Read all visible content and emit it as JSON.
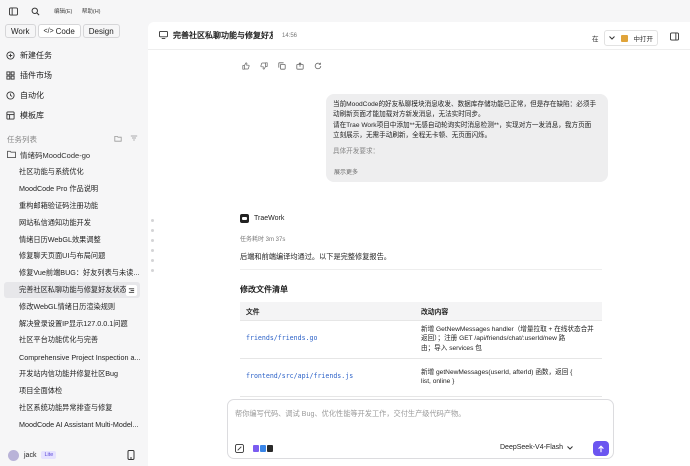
{
  "topbar": {
    "menu": [
      "编辑(E)",
      "帮助(H)"
    ]
  },
  "modes": [
    "Work",
    "Code",
    "Design"
  ],
  "nav": [
    "新建任务",
    "插件市场",
    "自动化",
    "模板库"
  ],
  "tasks_section": {
    "title": "任务列表"
  },
  "folder": {
    "name": "情绪码MoodCode-go"
  },
  "tasks": [
    "社区功能与系统优化",
    "MoodCode Pro 作品说明",
    "重构邮箱验证码注册功能",
    "网站私信通知功能开发",
    "情绪日历WebGL效果调整",
    "修复聊天页面UI与布局问题",
    "修复Vue前端BUG：好友列表与未读...",
    "完善社区私聊功能与修复好友状态",
    "修改WebGL情绪日历渲染规则",
    "解决登录设置IP显示127.0.0.1问题",
    "社区平台功能优化与完善",
    "Comprehensive Project Inspection a...",
    "开发站内信功能并修复社区Bug",
    "项目全面体检",
    "社区系统功能异常排查与修复",
    "MoodCode AI Assistant Multi-Model..."
  ],
  "active_task_index": 7,
  "user": {
    "name": "jack",
    "plan": "Lite"
  },
  "header": {
    "title": "完善社区私聊功能与修复好友...",
    "time": "14:56",
    "open_in_prefix": "在",
    "open_in_label": "中打开"
  },
  "bubble": {
    "lines": [
      "当前MoodCode的好友私聊模块消息收发、数据库存储功能已正常，但是存在缺陷：必须手",
      "动刷新页面才能加载对方新发消息，无法实时同步。",
      "请在Trae Work项目中添加**无感自动轮询实时消息检测**，实现对方一发消息，我方页面",
      "立刻展示，无需手动刷新，全程无卡顿、无页面闪烁。"
    ],
    "fade_line": "具体开发要求：",
    "expand": "展示更多"
  },
  "agent": {
    "name": "TraeWork",
    "elapsed": "任务耗时 3m 37s",
    "summary": "后端和前端编译均通过。以下是完整修复报告。",
    "section_title": "修改文件清单",
    "table_headers": [
      "文件",
      "改动内容"
    ],
    "rows": [
      {
        "file": "friends/friends.go",
        "desc_a": "新增 GetNewMessages handler（增量拉取 + 在线状态合并",
        "desc_b": "返回）；注册 GET /api/friends/chat/:userId/new 路",
        "desc_c": "由；导入 services 包"
      },
      {
        "file": "frontend/src/api/friends.js",
        "desc_a": "新增 getNewMessages(userId, afterId) 函数，返回 {",
        "desc_b": "list, online }",
        "desc_c": ""
      }
    ]
  },
  "composer": {
    "placeholder": "帮你编写代码、调试 Bug、优化性能等开发工作，交付生产级代码产物。",
    "model": "DeepSeek-V4-Flash"
  },
  "colors": {
    "accent": "#6b55f0",
    "link": "#2e63c8"
  }
}
